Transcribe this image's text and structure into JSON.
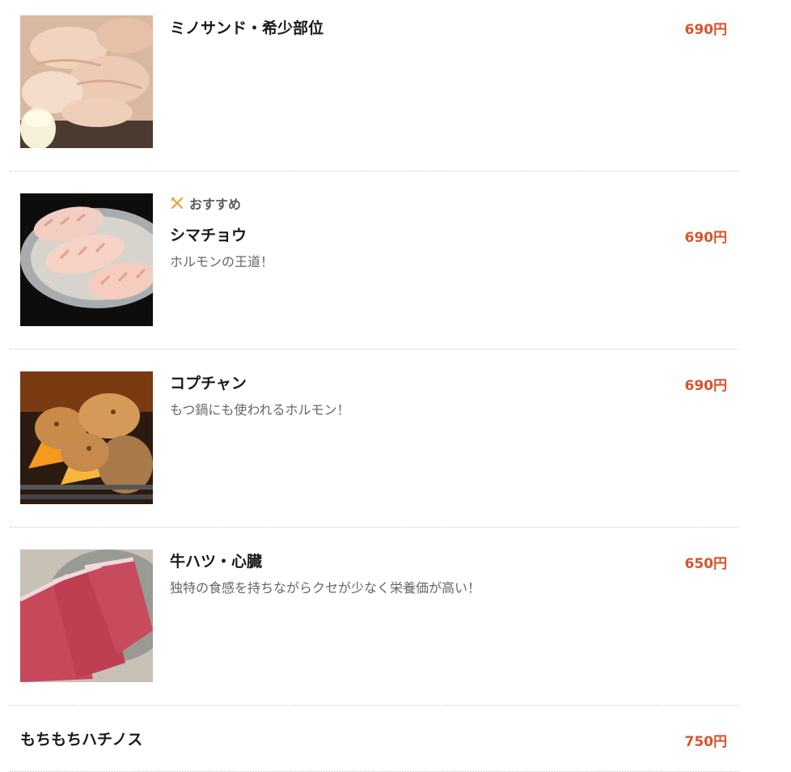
{
  "items": [
    {
      "name": "ミノサンド・希少部位",
      "price": "690円",
      "image": "mino-sand-photo"
    },
    {
      "badge": "おすすめ",
      "badge_icon": "fork-knife-icon",
      "name": "シマチョウ",
      "price": "690円",
      "description": "ホルモンの王道！",
      "image": "shimachou-photo"
    },
    {
      "name": "コプチャン",
      "price": "690円",
      "description": "もつ鍋にも使われるホルモン！",
      "image": "kopuchan-photo"
    },
    {
      "name": "牛ハツ・心臓",
      "price": "650円",
      "description": "独特の食感を持ちながらクセが少なく栄養価が高い！",
      "image": "beef-heart-photo"
    },
    {
      "name": "もちもちハチノス",
      "price": "750円"
    }
  ],
  "colors": {
    "price": "#d9532c",
    "badge_icon": "#e8a33a",
    "divider": "#c9c9c9"
  }
}
